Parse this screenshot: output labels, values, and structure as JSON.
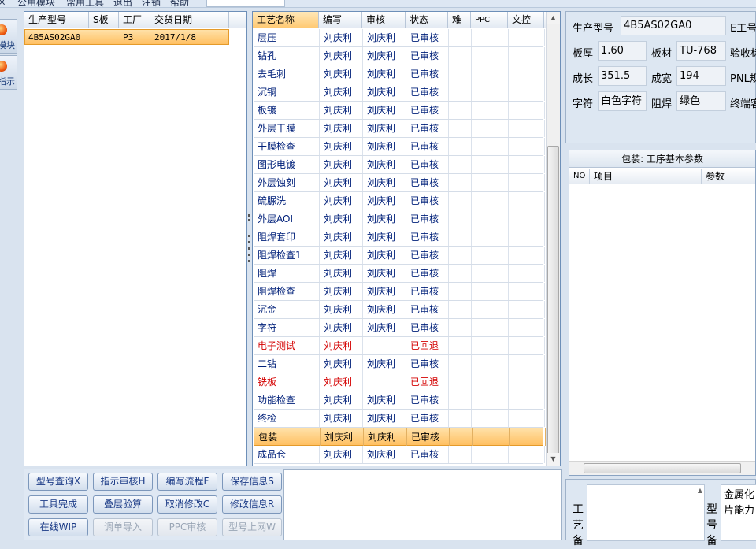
{
  "menubar": {
    "items": [
      "区",
      "公用模块",
      "常用工具",
      "退出",
      "注销",
      "帮助"
    ]
  },
  "leftnav": {
    "items": [
      {
        "label": "模块"
      },
      {
        "label": "指示"
      }
    ]
  },
  "product_table": {
    "columns": [
      "生产型号",
      "S板",
      "工厂",
      "交货日期"
    ],
    "rows": [
      {
        "model": "4B5AS02GA0",
        "s": "",
        "factory": "P3",
        "date": "2017/1/8"
      }
    ]
  },
  "process_table": {
    "columns": [
      "工艺名称",
      "编写",
      "审核",
      "状态",
      "难",
      "PPC",
      "文控"
    ],
    "rows": [
      {
        "name": "层压",
        "author": "刘庆利",
        "reviewer": "刘庆利",
        "status": "已审核"
      },
      {
        "name": "钻孔",
        "author": "刘庆利",
        "reviewer": "刘庆利",
        "status": "已审核"
      },
      {
        "name": "去毛刺",
        "author": "刘庆利",
        "reviewer": "刘庆利",
        "status": "已审核"
      },
      {
        "name": "沉铜",
        "author": "刘庆利",
        "reviewer": "刘庆利",
        "status": "已审核"
      },
      {
        "name": "板镀",
        "author": "刘庆利",
        "reviewer": "刘庆利",
        "status": "已审核"
      },
      {
        "name": "外层干膜",
        "author": "刘庆利",
        "reviewer": "刘庆利",
        "status": "已审核"
      },
      {
        "name": "干膜检查",
        "author": "刘庆利",
        "reviewer": "刘庆利",
        "status": "已审核"
      },
      {
        "name": "图形电镀",
        "author": "刘庆利",
        "reviewer": "刘庆利",
        "status": "已审核"
      },
      {
        "name": "外层蚀刻",
        "author": "刘庆利",
        "reviewer": "刘庆利",
        "status": "已审核"
      },
      {
        "name": "硫脲洗",
        "author": "刘庆利",
        "reviewer": "刘庆利",
        "status": "已审核"
      },
      {
        "name": "外层AOI",
        "author": "刘庆利",
        "reviewer": "刘庆利",
        "status": "已审核"
      },
      {
        "name": "阻焊套印",
        "author": "刘庆利",
        "reviewer": "刘庆利",
        "status": "已审核"
      },
      {
        "name": "阻焊检查1",
        "author": "刘庆利",
        "reviewer": "刘庆利",
        "status": "已审核"
      },
      {
        "name": "阻焊",
        "author": "刘庆利",
        "reviewer": "刘庆利",
        "status": "已审核"
      },
      {
        "name": "阻焊检查",
        "author": "刘庆利",
        "reviewer": "刘庆利",
        "status": "已审核"
      },
      {
        "name": "沉金",
        "author": "刘庆利",
        "reviewer": "刘庆利",
        "status": "已审核"
      },
      {
        "name": "字符",
        "author": "刘庆利",
        "reviewer": "刘庆利",
        "status": "已审核"
      },
      {
        "name": "电子测试",
        "author": "刘庆利",
        "reviewer": "",
        "status": "已回退",
        "returned": true
      },
      {
        "name": "二钻",
        "author": "刘庆利",
        "reviewer": "刘庆利",
        "status": "已审核"
      },
      {
        "name": "铣板",
        "author": "刘庆利",
        "reviewer": "",
        "status": "已回退",
        "returned": true
      },
      {
        "name": "功能检查",
        "author": "刘庆利",
        "reviewer": "刘庆利",
        "status": "已审核"
      },
      {
        "name": "终检",
        "author": "刘庆利",
        "reviewer": "刘庆利",
        "status": "已审核"
      },
      {
        "name": "包装",
        "author": "刘庆利",
        "reviewer": "刘庆利",
        "status": "已审核",
        "selected": true
      },
      {
        "name": "成品仓",
        "author": "刘庆利",
        "reviewer": "刘庆利",
        "status": "已审核"
      }
    ]
  },
  "buttons": [
    {
      "label": "型号查询X",
      "enabled": true
    },
    {
      "label": "指示审核H",
      "enabled": true
    },
    {
      "label": "编写流程F",
      "enabled": true
    },
    {
      "label": "保存信息S",
      "enabled": true
    },
    {
      "label": "工具完成",
      "enabled": true
    },
    {
      "label": "叠层验算",
      "enabled": true
    },
    {
      "label": "取消修改C",
      "enabled": true
    },
    {
      "label": "修改信息R",
      "enabled": true
    },
    {
      "label": "在线WIP",
      "enabled": true
    },
    {
      "label": "调单导入",
      "enabled": false
    },
    {
      "label": "PPC审核",
      "enabled": false
    },
    {
      "label": "型号上网W",
      "enabled": false
    }
  ],
  "info": {
    "model_label": "生产型号",
    "model_value": "4B5AS02GA0",
    "e_label": "E工号",
    "thickness_label": "板厚",
    "thickness_value": "1.60",
    "material_label": "板材",
    "material_value": "TU-768",
    "accept_label": "验收标",
    "length_label": "成长",
    "length_value": "351.5",
    "width_label": "成宽",
    "width_value": "194",
    "pnl_label": "PNL规",
    "char_label": "字符",
    "char_value": "白色字符",
    "mask_label": "阻焊",
    "mask_value": "绿色",
    "term_label": "终端客"
  },
  "params": {
    "title": "包装: 工序基本参数",
    "col_no": "NO",
    "col_item": "项目",
    "col_param": "参数"
  },
  "bottom": {
    "left_label": "工艺备",
    "mid_label": "型号备",
    "note": "金属化 片能力"
  }
}
